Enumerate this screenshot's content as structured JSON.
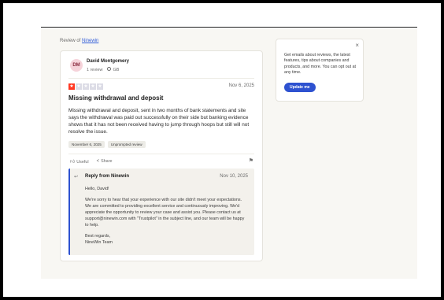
{
  "breadcrumb": {
    "prefix": "Review of",
    "company": "Ninewin"
  },
  "review": {
    "avatar_initials": "DM",
    "author": "David Montgomery",
    "review_count": "1 review",
    "country": "GB",
    "rating": 1,
    "rating_max": 5,
    "date": "Nov 6, 2025",
    "title": "Missing withdrawal and deposit",
    "body": "Missing withdrawal and deposit, sent in two months of bank statements and site says the withdrawal was paid out successfully on their side but banking evidence shows that it has not been received having to jump through hoops but still will not resolve the issue.",
    "tags": [
      "November 6, 2025",
      "Unprompted review"
    ],
    "useful_label": "Useful",
    "share_label": "Share"
  },
  "reply": {
    "heading": "Reply from Ninewin",
    "date": "Nov 10, 2025",
    "greeting": "Hello, David!",
    "paragraph": "We're sorry to hear that your experience with our site didn't meet your expectations. We are committed to providing excellent service and continuously improving. We'd appreciate the opportunity to review your case and assist you. Please contact us at support@ninewin.com with \"Trustpilot\" in the subject line, and our team will be happy to help.",
    "signoff": "Best regards,",
    "signature": "NineWin Team"
  },
  "promo": {
    "text": "Get emails about reviews, the latest features, tips about companies and products, and more. You can opt out at any time.",
    "button_label": "Update me"
  },
  "colors": {
    "accent": "#2e52d0",
    "star_on": "#ff3722",
    "star_off": "#dcdce6"
  }
}
